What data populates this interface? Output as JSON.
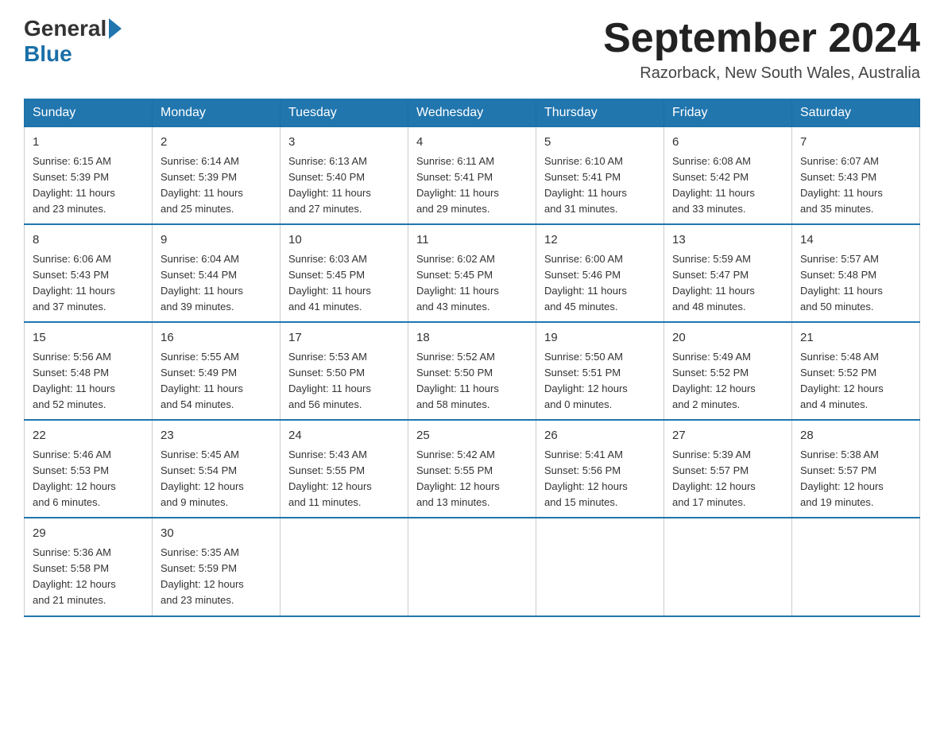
{
  "header": {
    "logo": {
      "general": "General",
      "blue": "Blue"
    },
    "title": "September 2024",
    "location": "Razorback, New South Wales, Australia"
  },
  "days_of_week": [
    "Sunday",
    "Monday",
    "Tuesday",
    "Wednesday",
    "Thursday",
    "Friday",
    "Saturday"
  ],
  "weeks": [
    [
      {
        "day": "1",
        "sunrise": "6:15 AM",
        "sunset": "5:39 PM",
        "daylight": "11 hours and 23 minutes."
      },
      {
        "day": "2",
        "sunrise": "6:14 AM",
        "sunset": "5:39 PM",
        "daylight": "11 hours and 25 minutes."
      },
      {
        "day": "3",
        "sunrise": "6:13 AM",
        "sunset": "5:40 PM",
        "daylight": "11 hours and 27 minutes."
      },
      {
        "day": "4",
        "sunrise": "6:11 AM",
        "sunset": "5:41 PM",
        "daylight": "11 hours and 29 minutes."
      },
      {
        "day": "5",
        "sunrise": "6:10 AM",
        "sunset": "5:41 PM",
        "daylight": "11 hours and 31 minutes."
      },
      {
        "day": "6",
        "sunrise": "6:08 AM",
        "sunset": "5:42 PM",
        "daylight": "11 hours and 33 minutes."
      },
      {
        "day": "7",
        "sunrise": "6:07 AM",
        "sunset": "5:43 PM",
        "daylight": "11 hours and 35 minutes."
      }
    ],
    [
      {
        "day": "8",
        "sunrise": "6:06 AM",
        "sunset": "5:43 PM",
        "daylight": "11 hours and 37 minutes."
      },
      {
        "day": "9",
        "sunrise": "6:04 AM",
        "sunset": "5:44 PM",
        "daylight": "11 hours and 39 minutes."
      },
      {
        "day": "10",
        "sunrise": "6:03 AM",
        "sunset": "5:45 PM",
        "daylight": "11 hours and 41 minutes."
      },
      {
        "day": "11",
        "sunrise": "6:02 AM",
        "sunset": "5:45 PM",
        "daylight": "11 hours and 43 minutes."
      },
      {
        "day": "12",
        "sunrise": "6:00 AM",
        "sunset": "5:46 PM",
        "daylight": "11 hours and 45 minutes."
      },
      {
        "day": "13",
        "sunrise": "5:59 AM",
        "sunset": "5:47 PM",
        "daylight": "11 hours and 48 minutes."
      },
      {
        "day": "14",
        "sunrise": "5:57 AM",
        "sunset": "5:48 PM",
        "daylight": "11 hours and 50 minutes."
      }
    ],
    [
      {
        "day": "15",
        "sunrise": "5:56 AM",
        "sunset": "5:48 PM",
        "daylight": "11 hours and 52 minutes."
      },
      {
        "day": "16",
        "sunrise": "5:55 AM",
        "sunset": "5:49 PM",
        "daylight": "11 hours and 54 minutes."
      },
      {
        "day": "17",
        "sunrise": "5:53 AM",
        "sunset": "5:50 PM",
        "daylight": "11 hours and 56 minutes."
      },
      {
        "day": "18",
        "sunrise": "5:52 AM",
        "sunset": "5:50 PM",
        "daylight": "11 hours and 58 minutes."
      },
      {
        "day": "19",
        "sunrise": "5:50 AM",
        "sunset": "5:51 PM",
        "daylight": "12 hours and 0 minutes."
      },
      {
        "day": "20",
        "sunrise": "5:49 AM",
        "sunset": "5:52 PM",
        "daylight": "12 hours and 2 minutes."
      },
      {
        "day": "21",
        "sunrise": "5:48 AM",
        "sunset": "5:52 PM",
        "daylight": "12 hours and 4 minutes."
      }
    ],
    [
      {
        "day": "22",
        "sunrise": "5:46 AM",
        "sunset": "5:53 PM",
        "daylight": "12 hours and 6 minutes."
      },
      {
        "day": "23",
        "sunrise": "5:45 AM",
        "sunset": "5:54 PM",
        "daylight": "12 hours and 9 minutes."
      },
      {
        "day": "24",
        "sunrise": "5:43 AM",
        "sunset": "5:55 PM",
        "daylight": "12 hours and 11 minutes."
      },
      {
        "day": "25",
        "sunrise": "5:42 AM",
        "sunset": "5:55 PM",
        "daylight": "12 hours and 13 minutes."
      },
      {
        "day": "26",
        "sunrise": "5:41 AM",
        "sunset": "5:56 PM",
        "daylight": "12 hours and 15 minutes."
      },
      {
        "day": "27",
        "sunrise": "5:39 AM",
        "sunset": "5:57 PM",
        "daylight": "12 hours and 17 minutes."
      },
      {
        "day": "28",
        "sunrise": "5:38 AM",
        "sunset": "5:57 PM",
        "daylight": "12 hours and 19 minutes."
      }
    ],
    [
      {
        "day": "29",
        "sunrise": "5:36 AM",
        "sunset": "5:58 PM",
        "daylight": "12 hours and 21 minutes."
      },
      {
        "day": "30",
        "sunrise": "5:35 AM",
        "sunset": "5:59 PM",
        "daylight": "12 hours and 23 minutes."
      },
      null,
      null,
      null,
      null,
      null
    ]
  ],
  "labels": {
    "sunrise": "Sunrise:",
    "sunset": "Sunset:",
    "daylight": "Daylight:"
  }
}
